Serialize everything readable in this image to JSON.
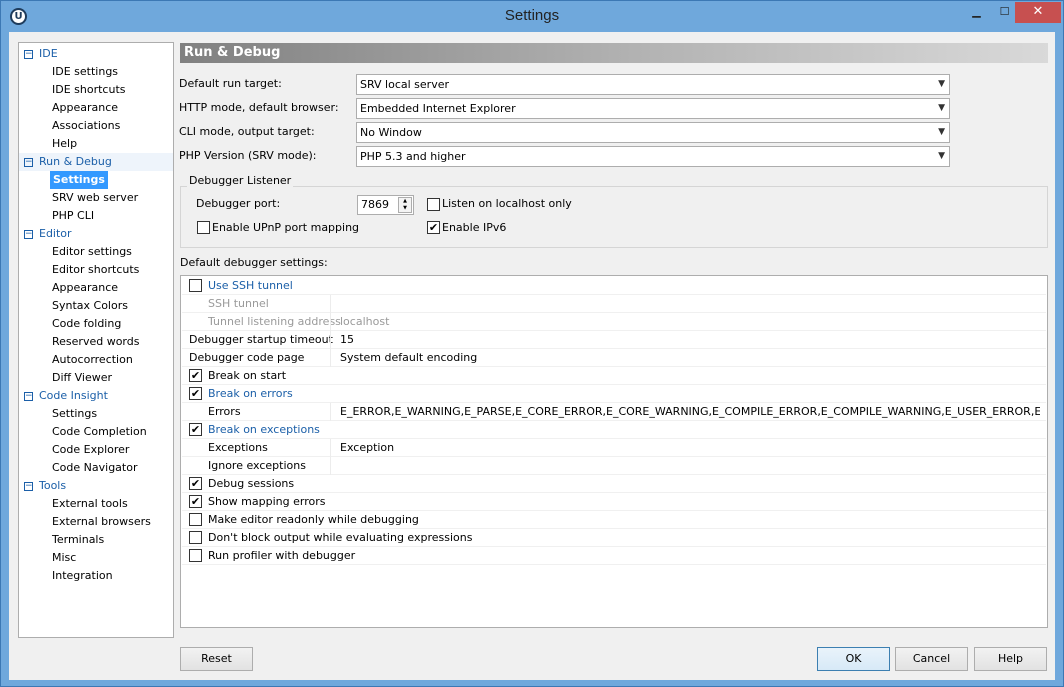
{
  "window": {
    "title": "Settings",
    "icon_glyph": "U"
  },
  "tree": {
    "categories": [
      {
        "label": "IDE",
        "items": [
          "IDE settings",
          "IDE shortcuts",
          "Appearance",
          "Associations",
          "Help"
        ]
      },
      {
        "label": "Run & Debug",
        "items": [
          "Settings",
          "SRV web server",
          "PHP CLI"
        ]
      },
      {
        "label": "Editor",
        "items": [
          "Editor settings",
          "Editor shortcuts",
          "Appearance",
          "Syntax Colors",
          "Code folding",
          "Reserved words",
          "Autocorrection",
          "Diff Viewer"
        ]
      },
      {
        "label": "Code Insight",
        "items": [
          "Settings",
          "Code Completion",
          "Code Explorer",
          "Code Navigator"
        ]
      },
      {
        "label": "Tools",
        "items": [
          "External tools",
          "External browsers",
          "Terminals",
          "Misc",
          "Integration"
        ]
      }
    ],
    "selected": "Settings"
  },
  "panel": {
    "title": "Run & Debug",
    "fields": [
      {
        "label": "Default run target:",
        "value": "SRV local server"
      },
      {
        "label": "HTTP mode, default browser:",
        "value": "Embedded Internet Explorer"
      },
      {
        "label": "CLI mode, output target:",
        "value": "No Window"
      },
      {
        "label": "PHP Version (SRV mode):",
        "value": "PHP 5.3 and higher"
      }
    ],
    "listener": {
      "title": "Debugger Listener",
      "port_label": "Debugger port:",
      "port_value": "7869",
      "localhost_label": "Listen on localhost only",
      "localhost_checked": false,
      "upnp_label": "Enable UPnP port mapping",
      "upnp_checked": false,
      "ipv6_label": "Enable IPv6",
      "ipv6_checked": true
    },
    "grid_title": "Default debugger settings:",
    "grid_rows": [
      {
        "check": false,
        "label": "Use SSH tunnel",
        "kind": "cat",
        "value": ""
      },
      {
        "label": "SSH tunnel",
        "kind": "dis",
        "value": ""
      },
      {
        "label": "Tunnel listening address",
        "kind": "dis",
        "value": "localhost"
      },
      {
        "label": "Debugger startup timeout",
        "kind": "plain0",
        "value": "15"
      },
      {
        "label": "Debugger code page",
        "kind": "plain0",
        "value": "System default encoding"
      },
      {
        "check": true,
        "label": "Break on start",
        "kind": "plain",
        "value": ""
      },
      {
        "check": true,
        "label": "Break on errors",
        "kind": "cat",
        "value": ""
      },
      {
        "label": "Errors",
        "kind": "plain",
        "value": "E_ERROR,E_WARNING,E_PARSE,E_CORE_ERROR,E_CORE_WARNING,E_COMPILE_ERROR,E_COMPILE_WARNING,E_USER_ERROR,E_USER..."
      },
      {
        "check": true,
        "label": "Break on exceptions",
        "kind": "cat",
        "value": ""
      },
      {
        "label": "Exceptions",
        "kind": "plain",
        "value": "Exception"
      },
      {
        "label": "Ignore exceptions",
        "kind": "plain",
        "value": ""
      },
      {
        "check": true,
        "label": "Debug sessions",
        "kind": "plain",
        "value": ""
      },
      {
        "check": true,
        "label": "Show mapping errors",
        "kind": "plain",
        "value": ""
      },
      {
        "check": false,
        "label": "Make editor readonly while debugging",
        "kind": "plain",
        "value": ""
      },
      {
        "check": false,
        "label": "Don't block output while evaluating expressions",
        "kind": "plain",
        "value": ""
      },
      {
        "check": false,
        "label": "Run profiler with debugger",
        "kind": "plain",
        "value": ""
      }
    ]
  },
  "buttons": {
    "reset": "Reset",
    "ok": "OK",
    "cancel": "Cancel",
    "help": "Help"
  },
  "colors": {
    "accent": "#1b5fa8",
    "selection": "#3399ff",
    "titlebar": "#6fa8dc",
    "close": "#c75050"
  }
}
